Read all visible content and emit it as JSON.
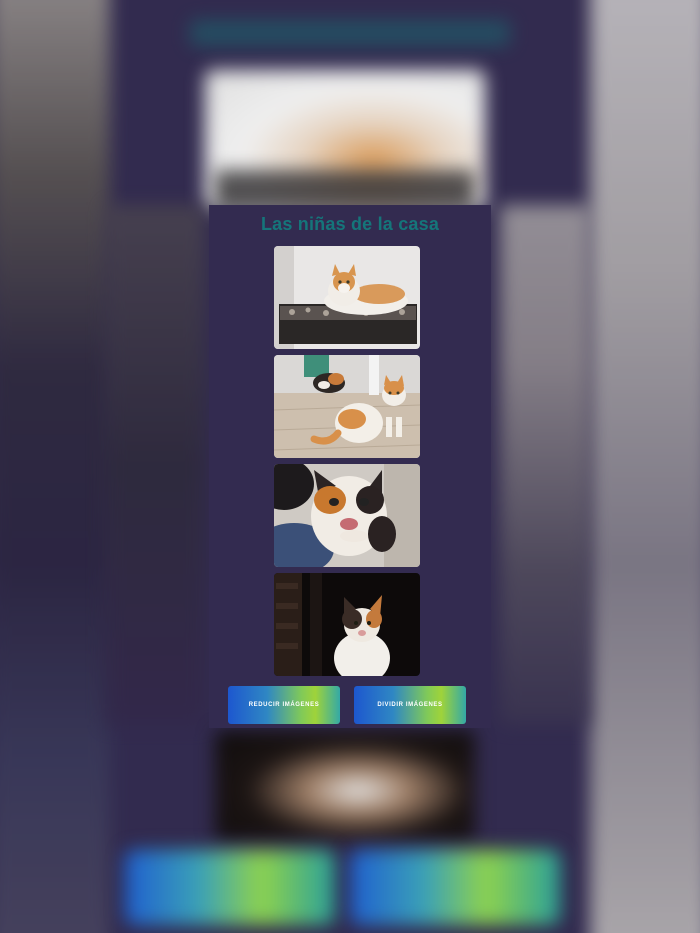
{
  "page": {
    "title": "Las niñas de la casa"
  },
  "gallery": {
    "photos": [
      {
        "alt": "cat-orange-white-lying"
      },
      {
        "alt": "two-cats-on-floor"
      },
      {
        "alt": "calico-cat-closeup"
      },
      {
        "alt": "calico-cat-dark-background"
      }
    ]
  },
  "buttons": {
    "left_label": "Reducir imágenes",
    "right_label": "Dividir imágenes"
  },
  "colors": {
    "background": "#322b4f",
    "title": "#15757a",
    "button_gradient_start": "#1d57cf",
    "button_gradient_mid": "#9fd33a",
    "button_gradient_end": "#34a9a6"
  }
}
